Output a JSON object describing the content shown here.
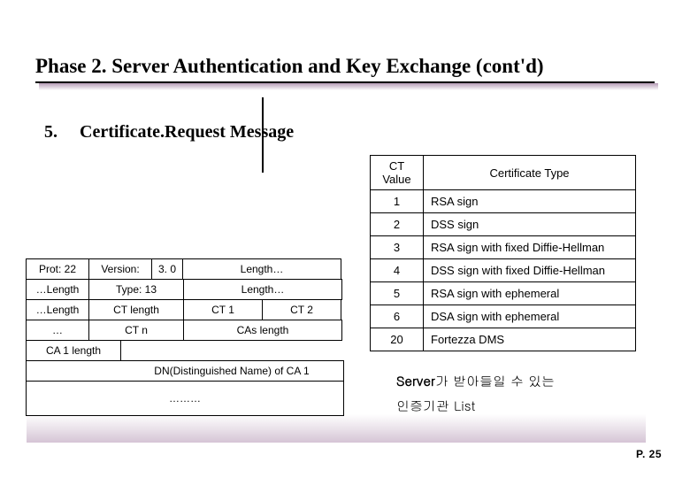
{
  "title": "Phase 2. Server Authentication and Key Exchange (cont'd)",
  "section": {
    "num": "5.",
    "title": "Certificate.Request Message"
  },
  "ct_table": {
    "head": {
      "value": "CT Value",
      "type": "Certificate Type"
    },
    "rows": [
      {
        "v": "1",
        "t": "RSA sign"
      },
      {
        "v": "2",
        "t": "DSS sign"
      },
      {
        "v": "3",
        "t": "RSA sign with fixed Diffie-Hellman"
      },
      {
        "v": "4",
        "t": "DSS sign with fixed Diffie-Hellman"
      },
      {
        "v": "5",
        "t": "RSA sign with ephemeral"
      },
      {
        "v": "6",
        "t": "DSA sign with ephemeral"
      },
      {
        "v": "20",
        "t": "Fortezza DMS"
      }
    ]
  },
  "struct": {
    "r0": {
      "prot": "Prot: 22",
      "version_lbl": "Version:",
      "version_val": "3. 0",
      "length": "Length…"
    },
    "r1": {
      "length_lbl": "…Length",
      "type": "Type: 13",
      "length2": "Length…"
    },
    "r2": {
      "length_lbl": "…Length",
      "ctlen": "CT length",
      "ct1": "CT 1",
      "ct2": "CT 2"
    },
    "r3": {
      "dots": "…",
      "ctn": "CT n",
      "calen": "CAs length"
    },
    "r4": {
      "ca1len": "CA 1 length"
    },
    "r5": {
      "dn": "DN(Distinguished Name) of CA 1"
    },
    "r6": {
      "dots": "………"
    }
  },
  "note": {
    "server": "Server",
    "line1_rest": "가 받아들일 수 있는",
    "line2": "인증기관 List"
  },
  "page": "P. 25"
}
